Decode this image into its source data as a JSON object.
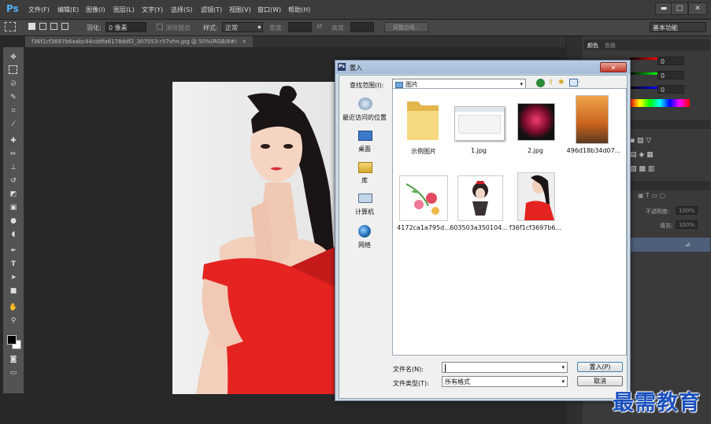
{
  "app": {
    "logo": "Ps"
  },
  "menu": [
    "文件(F)",
    "编辑(E)",
    "图像(I)",
    "图层(L)",
    "文字(Y)",
    "选择(S)",
    "滤镜(T)",
    "视图(V)",
    "窗口(W)",
    "帮助(H)"
  ],
  "window_controls": {
    "minimize": "▬",
    "maximize": "□",
    "close": "✕"
  },
  "options": {
    "feather_label": "羽化:",
    "feather_value": "0 像素",
    "antialias_label": "消除锯齿",
    "style_label": "样式:",
    "style_value": "正常",
    "width_label": "宽度:",
    "height_label": "高度:",
    "refine_edge": "调整边缘...",
    "workspace": "基本功能"
  },
  "document_tab": "f36f1cf3697b6aabc44cddfa6178ddf2_307053-r57vhn.jpg @ 50%(RGB/8#)",
  "document_tab_close": "×",
  "right_panel": {
    "tab1": "颜色",
    "tab2": "色板",
    "r_value": "0",
    "g_value": "0",
    "b_value": "0",
    "opacity_label": "不透明度:",
    "opacity_value": "100%",
    "fill_label": "填充:",
    "fill_value": "100%"
  },
  "dialog": {
    "title": "置入",
    "close": "✕",
    "look_in_label": "查找范围(I):",
    "look_in_value": "图片",
    "nav": [
      {
        "label": "最近访问的位置"
      },
      {
        "label": "桌面"
      },
      {
        "label": "库"
      },
      {
        "label": "计算机"
      },
      {
        "label": "网络"
      }
    ],
    "files": [
      {
        "label": "示例图片"
      },
      {
        "label": "1.jpg"
      },
      {
        "label": "2.jpg"
      },
      {
        "label": "496d18b34d07..."
      },
      {
        "label": "4172ca1a795d..."
      },
      {
        "label": "603503a350104..."
      },
      {
        "label": "f36f1cf3697b6..."
      }
    ],
    "filename_label": "文件名(N):",
    "filename_value": "",
    "filetype_label": "文件类型(T):",
    "filetype_value": "所有格式",
    "place_button": "置入(P)",
    "cancel_button": "取消"
  },
  "watermark": "最需教育"
}
